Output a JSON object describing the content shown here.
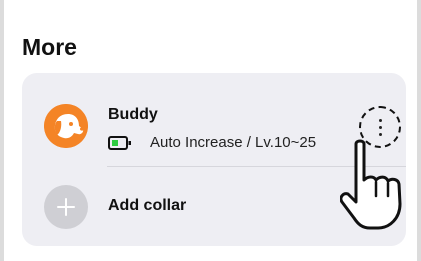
{
  "page": {
    "title": "More"
  },
  "collar": {
    "name": "Buddy",
    "status": "Auto Increase / Lv.10~25",
    "battery_icon": "battery-icon",
    "avatar_icon": "dog-avatar",
    "menu_icon": "more-vertical-icon"
  },
  "add": {
    "label": "Add collar",
    "icon": "plus-icon"
  },
  "colors": {
    "accent": "#f48426",
    "battery": "#2ecc40",
    "card_background": "#eeeef3",
    "add_icon_background": "#cfcfd4"
  }
}
